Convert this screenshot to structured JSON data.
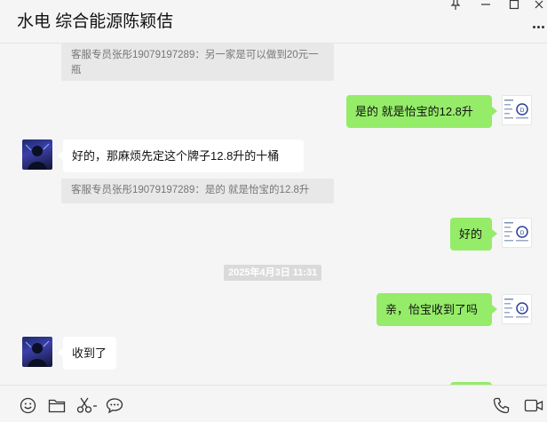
{
  "window": {
    "title": "水电 综合能源陈颖佶"
  },
  "messages": [
    {
      "kind": "quote",
      "text": "客服专员张彤19079197289：另一家是可以做到20元一瓶"
    },
    {
      "kind": "outgoing",
      "text": "是的 就是怡宝的12.8升"
    },
    {
      "kind": "incoming",
      "text": "好的，那麻烦先定这个牌子12.8升的十桶"
    },
    {
      "kind": "quote",
      "text": "客服专员张彤19079197289：是的 就是怡宝的12.8升"
    },
    {
      "kind": "outgoing",
      "text": "好的"
    },
    {
      "kind": "timestamp",
      "text": "2025年4月3日 11:31"
    },
    {
      "kind": "outgoing",
      "text": "亲，怡宝收到了吗"
    },
    {
      "kind": "incoming",
      "text": "收到了"
    }
  ],
  "toolbar": {
    "icons": [
      "emoji-icon",
      "folder-icon",
      "scissors-icon",
      "chat-history-icon",
      "phone-icon",
      "video-call-icon"
    ]
  },
  "colors": {
    "outgoing_bubble": "#95ec69",
    "incoming_bubble": "#ffffff",
    "background": "#f5f5f5",
    "quote_background": "#e8e8e8"
  }
}
